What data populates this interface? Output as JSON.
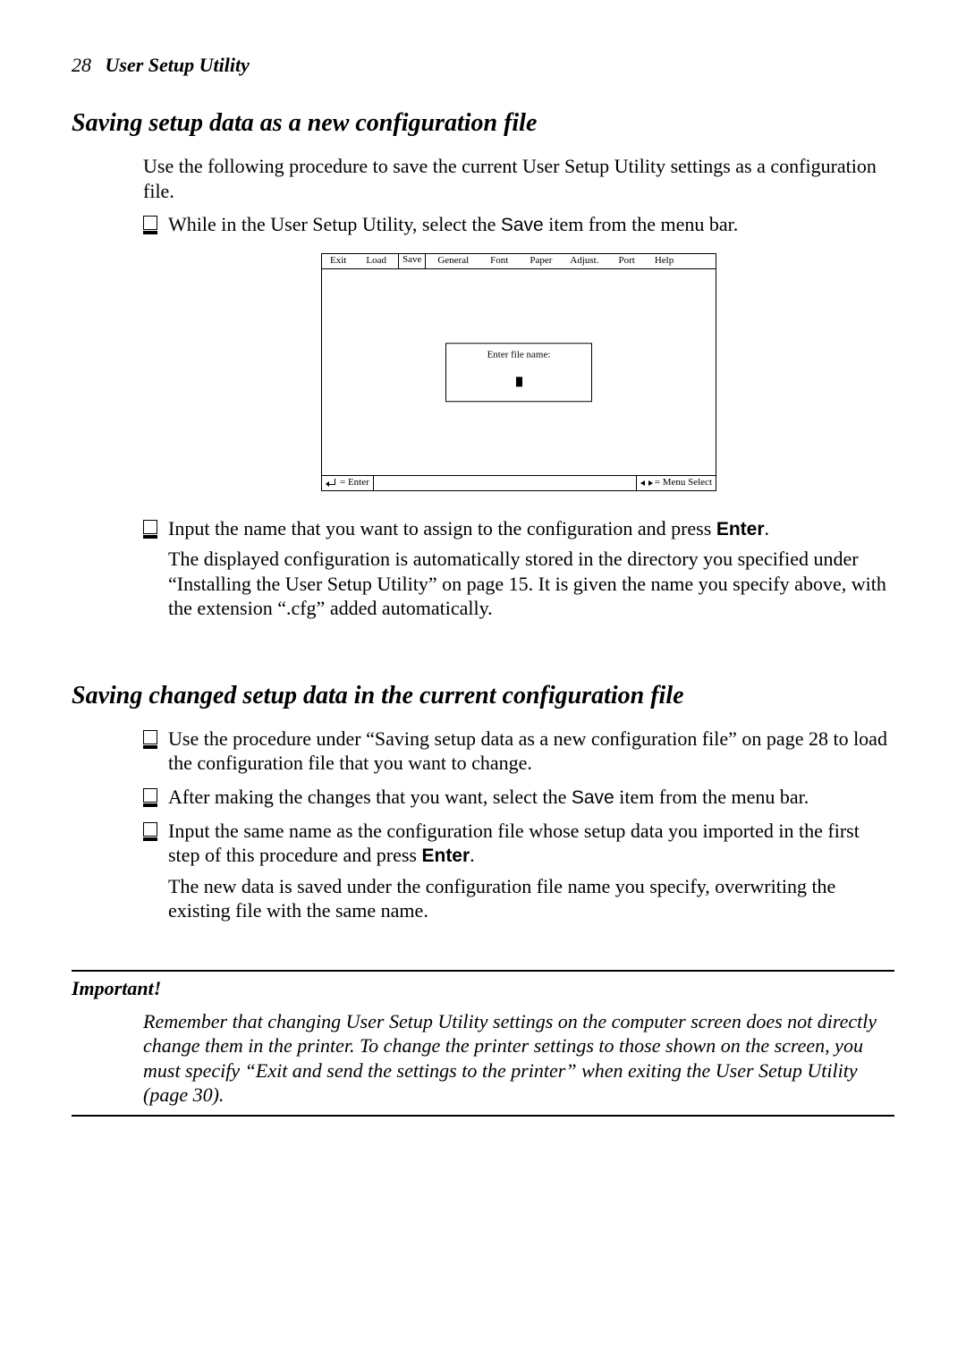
{
  "header": {
    "page_number": "28",
    "title": "User Setup Utility"
  },
  "section1": {
    "heading": "Saving setup data as a new configuration file",
    "intro": "Use the following procedure to save the current User Setup Utility settings as a configuration file.",
    "b1_pre": "While in the User Setup Utility, select the ",
    "b1_key": "Save",
    "b1_post": " item from the menu bar.",
    "b2_pre": "Input the name that you want to assign to the configuration and press ",
    "b2_key": "Enter",
    "b2_post": ".",
    "b2_para": "The displayed configuration is automatically stored in the directory you specified under “Installing the User Setup Utility” on page 15. It is given the name you specify above, with the extension “.cfg” added automatically."
  },
  "dialog": {
    "menu": {
      "exit": "Exit",
      "load": "Load",
      "save": "Save",
      "general": "General",
      "font": "Font",
      "paper": "Paper",
      "adjust": "Adjust.",
      "port": "Port",
      "help": "Help"
    },
    "popup_label": "Enter file name:",
    "status_enter": " = Enter",
    "status_menu": " = Menu Select"
  },
  "section2": {
    "heading": "Saving changed setup data in the current configuration file",
    "b1": "Use the procedure under “Saving setup data as a new configuration file” on page 28 to load the configuration file that you want to change.",
    "b2_pre": "After making the changes that you want, select the ",
    "b2_key": "Save",
    "b2_post": " item from the menu bar.",
    "b3_pre": "Input the same name as the configuration file whose setup data you imported in the first step of this procedure and press ",
    "b3_key": "Enter",
    "b3_post": ".",
    "b3_para": "The new data is saved under the configuration file name you specify, overwriting the existing file with the same name."
  },
  "important": {
    "label": "Important!",
    "body": "Remember that changing User Setup Utility settings on the computer screen does not directly change them in the printer. To change the printer settings to those shown on the screen, you must specify “Exit and send the settings to the printer” when exiting the User Setup Utility (page 30)."
  }
}
